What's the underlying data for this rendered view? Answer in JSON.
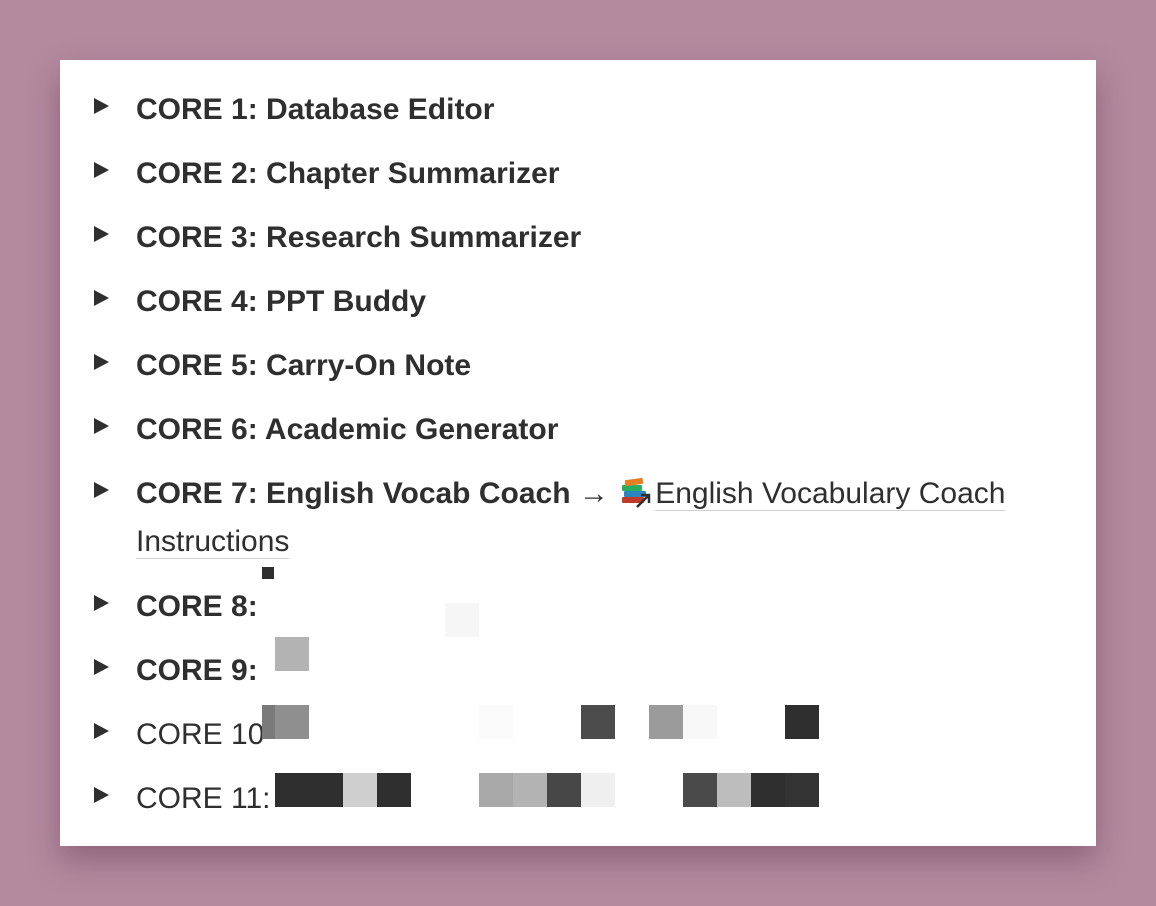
{
  "items": [
    {
      "prefix": "CORE 1:",
      "title": "Database Editor"
    },
    {
      "prefix": "CORE 2:",
      "title": "Chapter Summarizer"
    },
    {
      "prefix": "CORE 3:",
      "title": "Research Summarizer"
    },
    {
      "prefix": "CORE 4:",
      "title": "PPT Buddy"
    },
    {
      "prefix": "CORE 5:",
      "title": "Carry-On Note"
    },
    {
      "prefix": "CORE 6:",
      "title": "Academic Generator"
    },
    {
      "prefix": "CORE 7:",
      "title": "English Vocab Coach",
      "arrow": "→",
      "link_line1": "English Vocabulary Coach",
      "link_line2": "Instructions",
      "link_icon": "books-icon"
    },
    {
      "prefix": "CORE 8:",
      "title": ""
    },
    {
      "prefix": "CORE 9:",
      "title": ""
    },
    {
      "prefix": "CORE 10",
      "title": ""
    },
    {
      "prefix": "CORE 11:",
      "title": ""
    }
  ],
  "colors": {
    "background": "#b48a9f",
    "card": "#ffffff",
    "text": "#2f2f2f"
  }
}
